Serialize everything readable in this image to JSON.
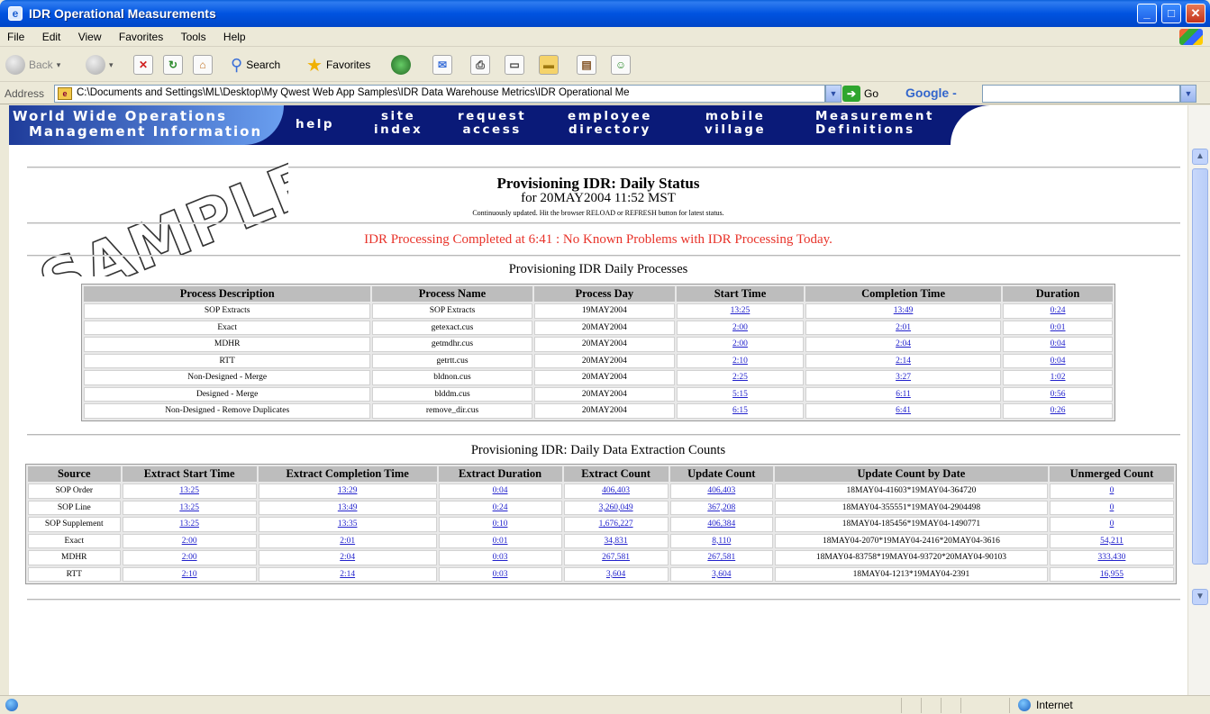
{
  "window": {
    "title": "IDR Operational Measurements"
  },
  "menu": [
    "File",
    "Edit",
    "View",
    "Favorites",
    "Tools",
    "Help"
  ],
  "toolbar": {
    "back": "Back",
    "search": "Search",
    "favorites": "Favorites"
  },
  "address": {
    "label": "Address",
    "value": "C:\\Documents and Settings\\ML\\Desktop\\My Qwest Web App Samples\\IDR Data Warehouse Metrics\\IDR Operational Me",
    "go": "Go",
    "google": "Google -"
  },
  "site_nav": {
    "brand_line1": "World Wide Operations",
    "brand_line2": "Management Information",
    "help": "help",
    "site_index": [
      "site",
      "index"
    ],
    "request_access": [
      "request",
      "access"
    ],
    "employee_directory": [
      "employee",
      "directory"
    ],
    "mobile_village": [
      "mobile",
      "village"
    ],
    "measurement_definitions": [
      "Measurement",
      "Definitions"
    ]
  },
  "watermark": "SAMPLE",
  "page": {
    "title": "Provisioning IDR: Daily Status",
    "subtitle": "for 20MAY2004 11:52 MST",
    "note": "Continuously updated. Hit the browser RELOAD or REFRESH button for latest status.",
    "status_message": "IDR Processing Completed at 6:41 :  No Known Problems with IDR Processing Today."
  },
  "processes": {
    "heading": "Provisioning IDR Daily Processes",
    "columns": [
      "Process Description",
      "Process Name",
      "Process Day",
      "Start Time",
      "Completion Time",
      "Duration"
    ],
    "rows": [
      [
        "SOP Extracts",
        "SOP Extracts",
        "19MAY2004",
        "13:25",
        "13:49",
        "0:24"
      ],
      [
        "Exact",
        "getexact.cus",
        "20MAY2004",
        "2:00",
        "2:01",
        "0:01"
      ],
      [
        "MDHR",
        "getmdhr.cus",
        "20MAY2004",
        "2:00",
        "2:04",
        "0:04"
      ],
      [
        "RTT",
        "getrtt.cus",
        "20MAY2004",
        "2:10",
        "2:14",
        "0:04"
      ],
      [
        "Non-Designed - Merge",
        "bldnon.cus",
        "20MAY2004",
        "2:25",
        "3:27",
        "1:02"
      ],
      [
        "Designed - Merge",
        "blddm.cus",
        "20MAY2004",
        "5:15",
        "6:11",
        "0:56"
      ],
      [
        "Non-Designed - Remove Duplicates",
        "remove_dir.cus",
        "20MAY2004",
        "6:15",
        "6:41",
        "0:26"
      ]
    ]
  },
  "extraction": {
    "heading": "Provisioning IDR: Daily Data Extraction Counts",
    "columns": [
      "Source",
      "Extract Start Time",
      "Extract Completion Time",
      "Extract Duration",
      "Extract Count",
      "Update Count",
      "Update Count by Date",
      "Unmerged Count"
    ],
    "rows": [
      [
        "SOP Order",
        "13:25",
        "13:29",
        "0:04",
        "406,403",
        "406,403",
        "18MAY04-41603*19MAY04-364720",
        "0"
      ],
      [
        "SOP Line",
        "13:25",
        "13:49",
        "0:24",
        "3,260,049",
        "367,208",
        "18MAY04-355551*19MAY04-2904498",
        "0"
      ],
      [
        "SOP Supplement",
        "13:25",
        "13:35",
        "0:10",
        "1,676,227",
        "406,384",
        "18MAY04-185456*19MAY04-1490771",
        "0"
      ],
      [
        "Exact",
        "2:00",
        "2:01",
        "0:01",
        "34,831",
        "8,110",
        "18MAY04-2070*19MAY04-2416*20MAY04-3616",
        "54,211"
      ],
      [
        "MDHR",
        "2:00",
        "2:04",
        "0:03",
        "267,581",
        "267,581",
        "18MAY04-83758*19MAY04-93720*20MAY04-90103",
        "333,430"
      ],
      [
        "RTT",
        "2:10",
        "2:14",
        "0:03",
        "3,604",
        "3,604",
        "18MAY04-1213*19MAY04-2391",
        "16,955"
      ]
    ]
  },
  "statusbar": {
    "zone": "Internet"
  }
}
